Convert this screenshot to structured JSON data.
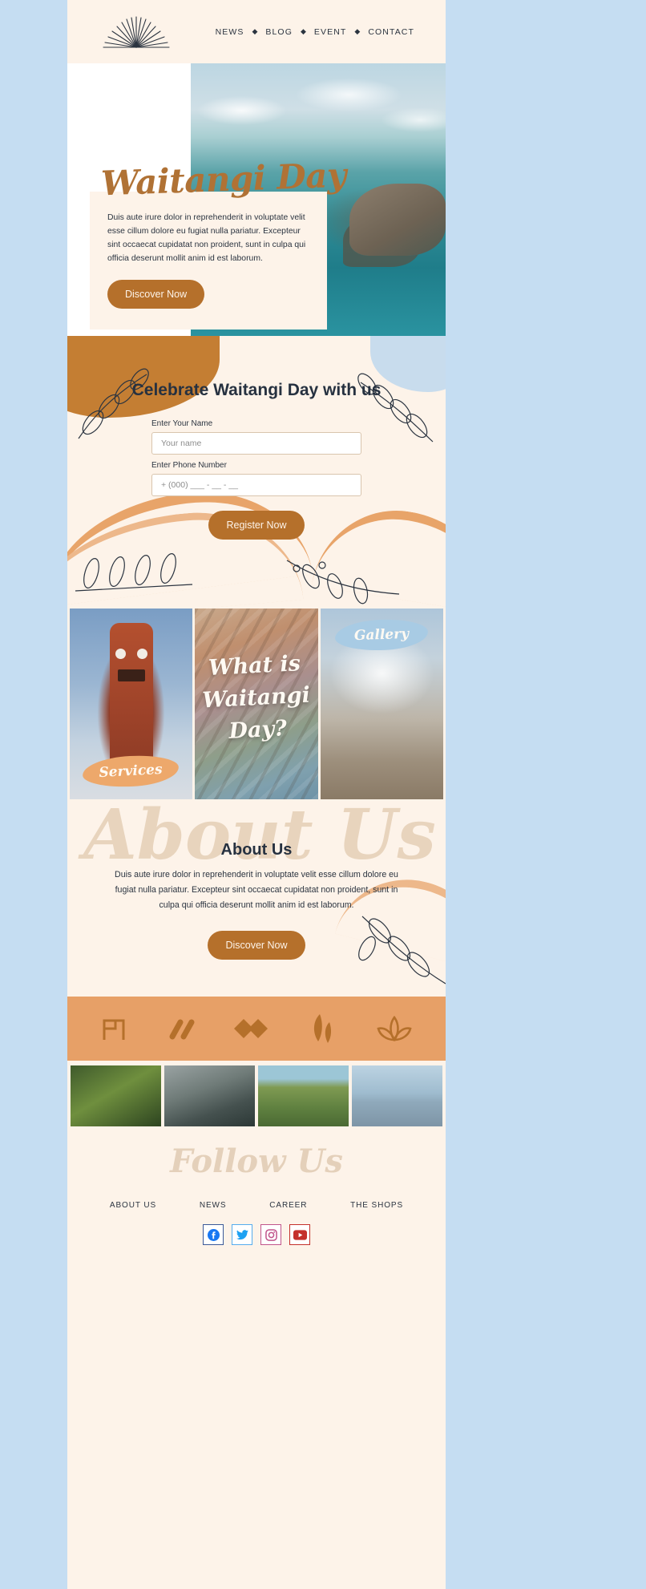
{
  "header": {
    "logo_icon": "sunburst-icon",
    "nav": [
      {
        "label": "NEWS"
      },
      {
        "label": "BLOG"
      },
      {
        "label": "EVENT"
      },
      {
        "label": "CONTACT"
      }
    ],
    "separator": "◆"
  },
  "hero": {
    "title": "Waitangi Day",
    "body": "Duis aute irure dolor in reprehenderit in voluptate velit esse cillum dolore eu fugiat nulla pariatur. Excepteur sint occaecat cupidatat non proident, sunt in culpa qui officia deserunt mollit anim id est laborum.",
    "cta": "Discover Now",
    "photo_alt": "coastal-ocean-photo"
  },
  "form": {
    "title": "Celebrate Waitangi Day with us",
    "name_label": "Enter Your Name",
    "name_placeholder": "Your name",
    "name_value": "",
    "phone_label": "Enter Phone Number",
    "phone_placeholder": "+ (000) ___ - __ - __",
    "phone_value": "",
    "submit": "Register Now"
  },
  "cards": [
    {
      "badge": "Services",
      "title": "",
      "image_alt": "maori-carved-tiki-pole"
    },
    {
      "badge": "",
      "title": "What is Waitangi Day?",
      "image_alt": "maori-carved-relief-wall"
    },
    {
      "badge": "Gallery",
      "title": "",
      "image_alt": "tiki-statue-in-steam"
    }
  ],
  "about": {
    "watermark": "About Us",
    "title": "About Us",
    "body": "Duis aute irure dolor in reprehenderit in voluptate velit esse cillum dolore eu fugiat nulla pariatur. Excepteur sint occaecat cupidatat non proident, sunt in culpa qui officia deserunt mollit anim id est laborum.",
    "cta": "Discover Now"
  },
  "icon_strip": [
    "monogram-r-icon",
    "double-slash-icon",
    "double-diamond-icon",
    "leaf-pair-icon",
    "lotus-icon"
  ],
  "thumbnails": [
    {
      "alt": "fern-frond-photo"
    },
    {
      "alt": "cave-rock-photo"
    },
    {
      "alt": "hillside-statue-photo"
    },
    {
      "alt": "coastal-island-photo"
    }
  ],
  "footer": {
    "heading": "Follow Us",
    "links": [
      {
        "label": "ABOUT US"
      },
      {
        "label": "NEWS"
      },
      {
        "label": "CAREER"
      },
      {
        "label": "THE SHOPS"
      }
    ],
    "socials": [
      {
        "name": "facebook-icon",
        "color": "#3b5998"
      },
      {
        "name": "twitter-icon",
        "color": "#55acee"
      },
      {
        "name": "instagram-icon",
        "color": "#c1558b"
      },
      {
        "name": "youtube-icon",
        "color": "#c4302b"
      }
    ]
  },
  "colors": {
    "accent": "#b5702b",
    "cream": "#fdf3e9",
    "orange": "#e7a067",
    "dark": "#263140",
    "page_bg": "#c5ddf2"
  }
}
